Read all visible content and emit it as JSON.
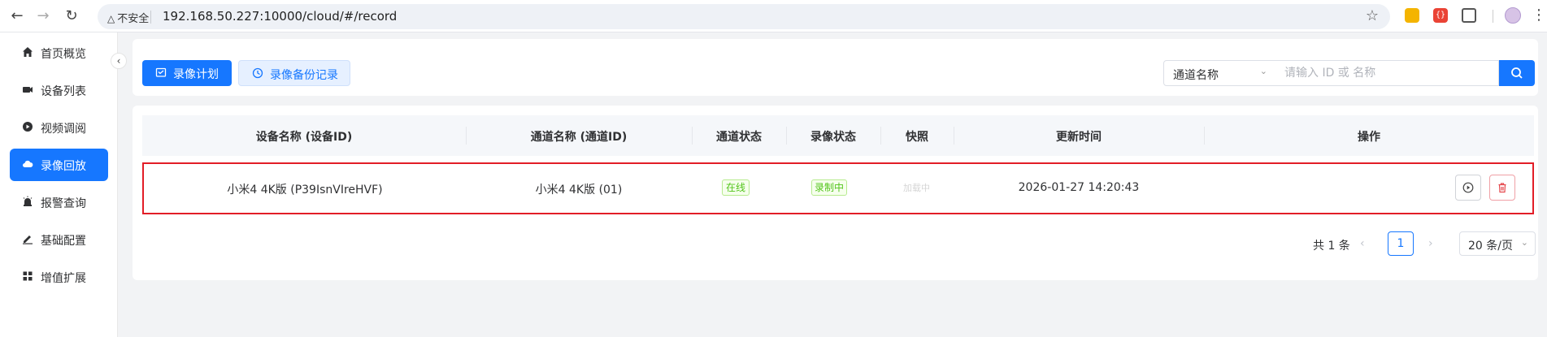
{
  "browser": {
    "security_label": "不安全",
    "url": "192.168.50.227:10000/cloud/#/record",
    "ext_b_label": "{}"
  },
  "sidebar": {
    "items": [
      {
        "label": "首页概览",
        "icon": "home-icon"
      },
      {
        "label": "设备列表",
        "icon": "camera-icon"
      },
      {
        "label": "视频调阅",
        "icon": "play-icon"
      },
      {
        "label": "录像回放",
        "icon": "cloud-icon",
        "active": true
      },
      {
        "label": "报警查询",
        "icon": "alarm-icon"
      },
      {
        "label": "基础配置",
        "icon": "edit-icon"
      },
      {
        "label": "增值扩展",
        "icon": "grid-icon"
      }
    ]
  },
  "toolbar": {
    "plan_button": "录像计划",
    "backup_button": "录像备份记录",
    "filter_select": "通道名称",
    "search_placeholder": "请输入 ID 或 名称"
  },
  "table": {
    "columns": [
      "设备名称 (设备ID)",
      "通道名称 (通道ID)",
      "通道状态",
      "录像状态",
      "快照",
      "更新时间",
      "操作"
    ],
    "rows": [
      {
        "device": "小米4 4K版 (P39IsnVIreHVF)",
        "channel": "小米4 4K版 (01)",
        "channel_status": "在线",
        "record_status": "录制中",
        "snapshot": "加载中",
        "updated": "2026-01-27 14:20:43"
      }
    ]
  },
  "pagination": {
    "total": "共 1 条",
    "current_page": "1",
    "page_size": "20 条/页"
  },
  "colors": {
    "primary": "#1677ff",
    "highlight_border": "#e21d27",
    "status_green": "#52c41a"
  }
}
